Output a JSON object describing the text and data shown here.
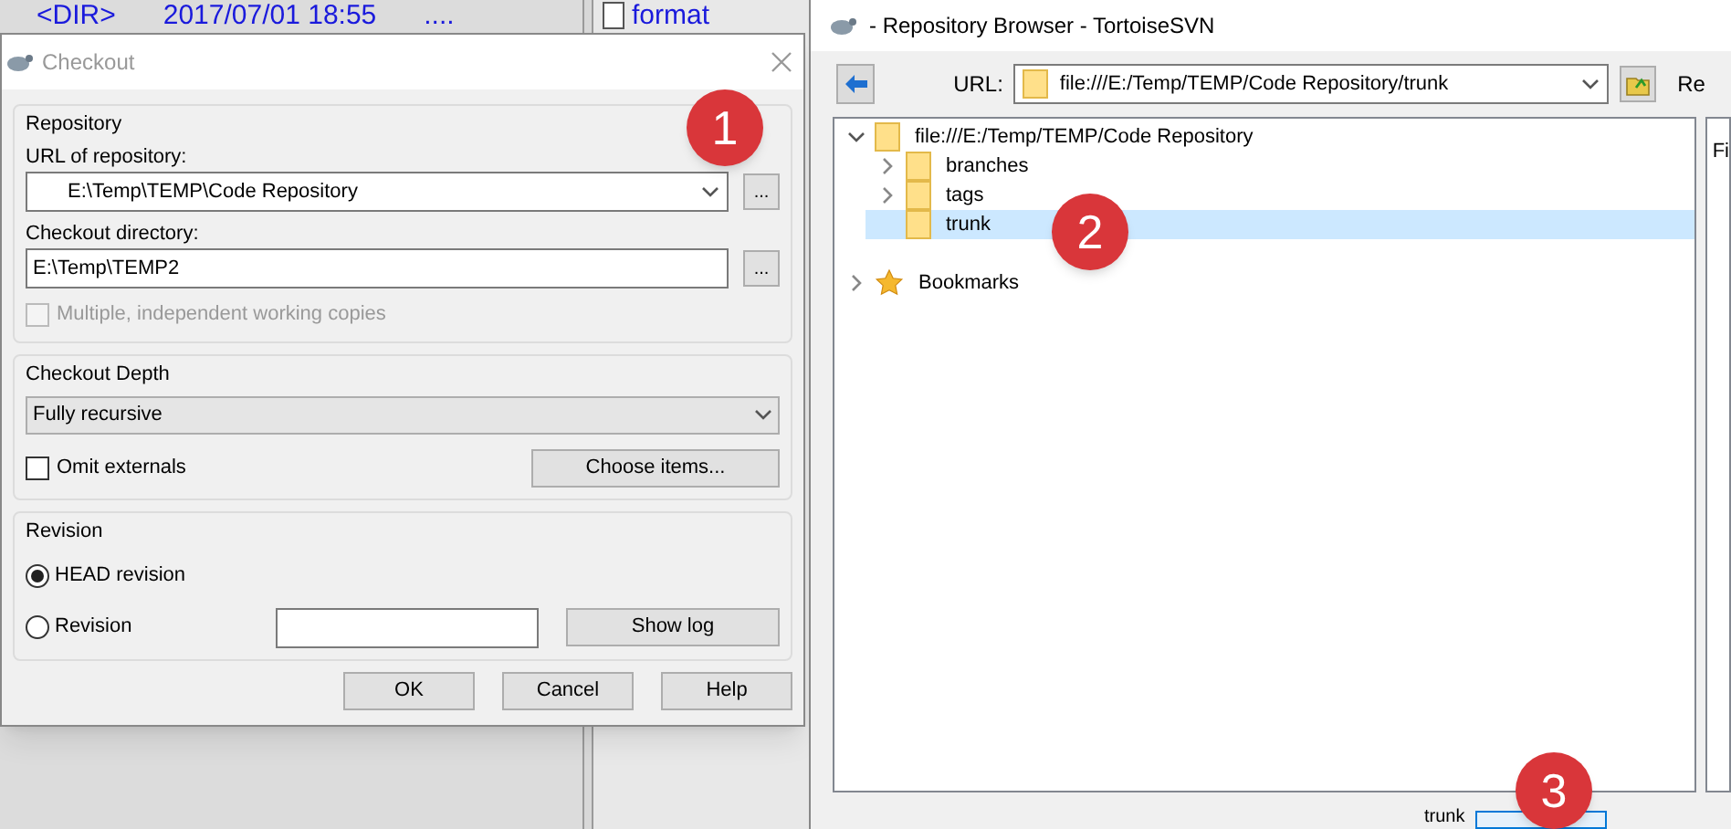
{
  "background": {
    "row": {
      "type": "<DIR>",
      "date": "2017/07/01 18:55",
      "extra": "...."
    },
    "file": "format"
  },
  "checkout": {
    "title": "Checkout",
    "repository_group": "Repository",
    "url_label": "URL of repository:",
    "url_value": "E:\\Temp\\TEMP\\Code Repository",
    "browse_button": "...",
    "dir_label": "Checkout directory:",
    "dir_value": "E:\\Temp\\TEMP2",
    "dir_browse_button": "...",
    "multiple": {
      "label": "Multiple, independent working copies",
      "checked": false,
      "disabled": true
    },
    "depth_group": "Checkout Depth",
    "depth_value": "Fully recursive",
    "omit": {
      "label": "Omit externals",
      "checked": false,
      "disabled": false
    },
    "choose_button": "Choose items...",
    "revision_group": "Revision",
    "revisions": [
      {
        "label": "HEAD revision",
        "selected": true
      },
      {
        "label": "Revision",
        "selected": false
      }
    ],
    "show_log_button": "Show log",
    "buttons": [
      "OK",
      "Cancel",
      "Help"
    ]
  },
  "repo_browser": {
    "title": "- Repository Browser - TortoiseSVN",
    "url_label": "URL:",
    "url_value": "file:///E:/Temp/TEMP/Code Repository/trunk",
    "right_header": "Re",
    "right_pane_text": "Fi",
    "tree": [
      {
        "label": "file:///E:/Temp/TEMP/Code Repository",
        "kind": "folder",
        "expanded": true,
        "selected": false,
        "children": [
          {
            "label": "branches",
            "kind": "folder",
            "expanded": false,
            "selected": false,
            "has_children": true
          },
          {
            "label": "tags",
            "kind": "folder",
            "expanded": false,
            "selected": false,
            "has_children": true
          },
          {
            "label": "trunk",
            "kind": "folder",
            "expanded": false,
            "selected": true,
            "has_children": false
          }
        ]
      },
      {
        "label": "Bookmarks",
        "kind": "bookmarks",
        "expanded": false,
        "selected": false,
        "has_children": true
      }
    ],
    "status_text": "trunk"
  },
  "badges": [
    "1",
    "2",
    "3"
  ]
}
